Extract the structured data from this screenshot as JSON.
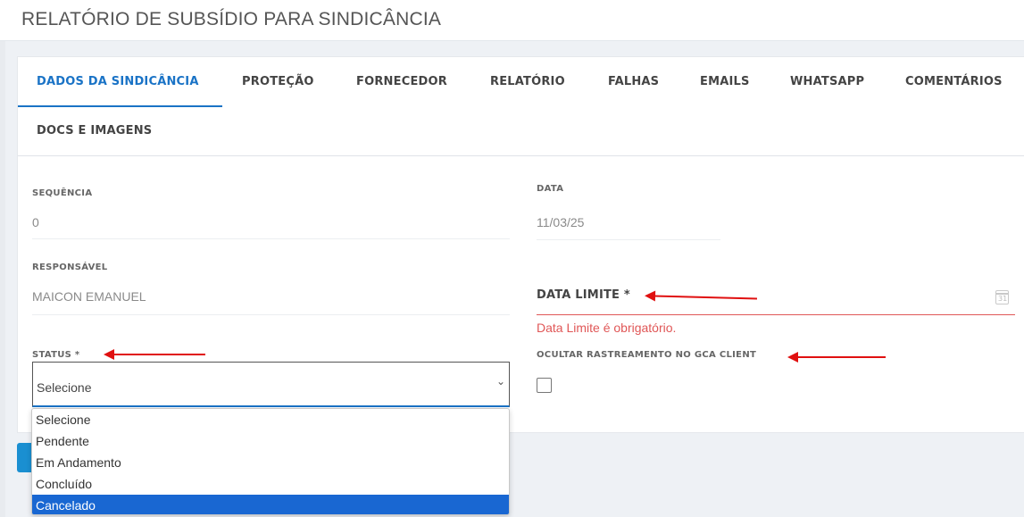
{
  "page": {
    "title": "RELATÓRIO DE SUBSÍDIO PARA SINDICÂNCIA"
  },
  "tabs": [
    {
      "label": "DADOS DA SINDICÂNCIA",
      "active": true
    },
    {
      "label": "PROTEÇÃO"
    },
    {
      "label": "FORNECEDOR"
    },
    {
      "label": "RELATÓRIO"
    },
    {
      "label": "FALHAS"
    },
    {
      "label": "EMAILS"
    },
    {
      "label": "WHATSAPP"
    },
    {
      "label": "COMENTÁRIOS"
    },
    {
      "label": "DOCS E IMAGENS"
    }
  ],
  "form": {
    "sequencia": {
      "label": "SEQUÊNCIA",
      "value": "0"
    },
    "data": {
      "label": "DATA",
      "value": "11/03/25"
    },
    "responsavel": {
      "label": "RESPONSÁVEL",
      "value": "MAICON EMANUEL"
    },
    "data_limite": {
      "label": "DATA LIMITE *",
      "error": "Data Limite é obrigatório.",
      "calendar_icon_text": "31"
    },
    "status": {
      "label": "STATUS *",
      "selected": "Selecione",
      "options": [
        "Selecione",
        "Pendente",
        "Em Andamento",
        "Concluído",
        "Cancelado"
      ],
      "highlighted": "Cancelado"
    },
    "ocultar": {
      "label": "OCULTAR RASTREAMENTO NO GCA CLIENT",
      "checked": false
    }
  },
  "colors": {
    "accent": "#1a73c6",
    "error": "#e05757",
    "annotation_arrow": "#e01010",
    "option_highlight": "#1967d2"
  },
  "icons": {
    "select_chevron": "chevron-down-icon",
    "date_picker": "calendar-icon"
  }
}
